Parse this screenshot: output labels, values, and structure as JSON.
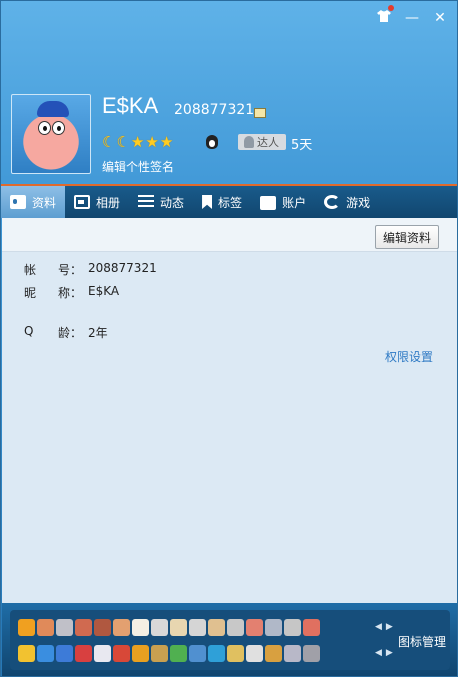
{
  "window": {
    "skin_icon": "tshirt-icon",
    "minimize_glyph": "—",
    "close_glyph": "✕"
  },
  "profile": {
    "nickname": "E$KA",
    "qq_number": "208877321",
    "level_icons": [
      "moon",
      "moon",
      "star",
      "star",
      "star"
    ],
    "moon_glyph": "☾",
    "star_glyph": "★",
    "daren_label": "达人",
    "days": "5天",
    "signature_placeholder": "编辑个性签名"
  },
  "tabs": [
    {
      "label": "资料",
      "icon": "profile-card-icon",
      "active": true
    },
    {
      "label": "相册",
      "icon": "photo-album-icon",
      "active": false
    },
    {
      "label": "动态",
      "icon": "feed-list-icon",
      "active": false
    },
    {
      "label": "标签",
      "icon": "bookmark-tag-icon",
      "active": false
    },
    {
      "label": "账户",
      "icon": "briefcase-icon",
      "active": false
    },
    {
      "label": "游戏",
      "icon": "game-icon",
      "active": false
    }
  ],
  "content": {
    "edit_button": "编辑资料",
    "fields": {
      "account": {
        "k1": "帐",
        "k2": "号：",
        "value": "208877321"
      },
      "nickname": {
        "k1": "昵",
        "k2": "称：",
        "value": "E$KA"
      },
      "age": {
        "k1": "Q",
        "k2": "龄：",
        "value": "2年"
      }
    },
    "permission_link": "权限设置"
  },
  "bottom": {
    "manage_label": "图标管理",
    "row1_colors": [
      "#f0a020",
      "#e08a5a",
      "#c0c0c8",
      "#d06a50",
      "#b05840",
      "#e3a070",
      "#f4f0e4",
      "#d8d8d8",
      "#e8d6b0",
      "#d5d5d5",
      "#e0c090",
      "#c8c8c8",
      "#e38070",
      "#b0b8c8",
      "#c6c6c6",
      "#e07060"
    ],
    "row2_colors": [
      "#f2c230",
      "#3a8ee0",
      "#3d7bd8",
      "#d84040",
      "#e8e8f0",
      "#d84838",
      "#e8a020",
      "#c8a050",
      "#50b050",
      "#5090d0",
      "#2fa0d8",
      "#e0c060",
      "#e0e0e0",
      "#d8a040",
      "#b8b8c8",
      "#a0a0a8"
    ]
  }
}
